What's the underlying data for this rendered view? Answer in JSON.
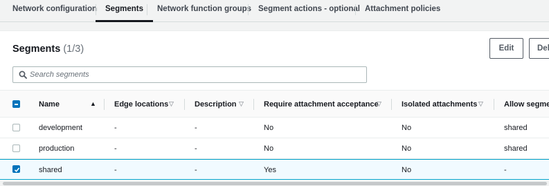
{
  "tabs": [
    {
      "label": "Network configuration"
    },
    {
      "label": "Segments"
    },
    {
      "label": "Network function groups"
    },
    {
      "label": "Segment actions - optional"
    },
    {
      "label": "Attachment policies"
    }
  ],
  "active_tab": "Segments",
  "panel": {
    "title": "Segments",
    "count": "(1/3)",
    "edit_label": "Edit",
    "delete_label": "Dele"
  },
  "search": {
    "placeholder": "Search segments",
    "value": ""
  },
  "columns": [
    {
      "label": "Name",
      "sort": "ascending"
    },
    {
      "label": "Edge locations",
      "sort": "none"
    },
    {
      "label": "Description",
      "sort": "none"
    },
    {
      "label": "Require attachment acceptance",
      "sort": "none"
    },
    {
      "label": "Isolated attachments",
      "sort": "none"
    },
    {
      "label": "Allow segmen",
      "sort": "none"
    }
  ],
  "rows": [
    {
      "name": "development",
      "edge_locations": "-",
      "description": "-",
      "require_acceptance": "No",
      "isolated": "No",
      "allow_segments": "shared",
      "selected": false
    },
    {
      "name": "production",
      "edge_locations": "-",
      "description": "-",
      "require_acceptance": "No",
      "isolated": "No",
      "allow_segments": "shared",
      "selected": false
    },
    {
      "name": "shared",
      "edge_locations": "-",
      "description": "-",
      "require_acceptance": "Yes",
      "isolated": "No",
      "allow_segments": "-",
      "selected": true
    }
  ],
  "icons": {
    "search": "search-icon",
    "sort_asc": "sort-ascending-icon",
    "sort_none": "sort-icon",
    "checkbox": "checkbox-icon"
  },
  "colors": {
    "accent": "#0073bb",
    "selected_row": "#f1faff",
    "selected_border": "#00a1c9"
  }
}
